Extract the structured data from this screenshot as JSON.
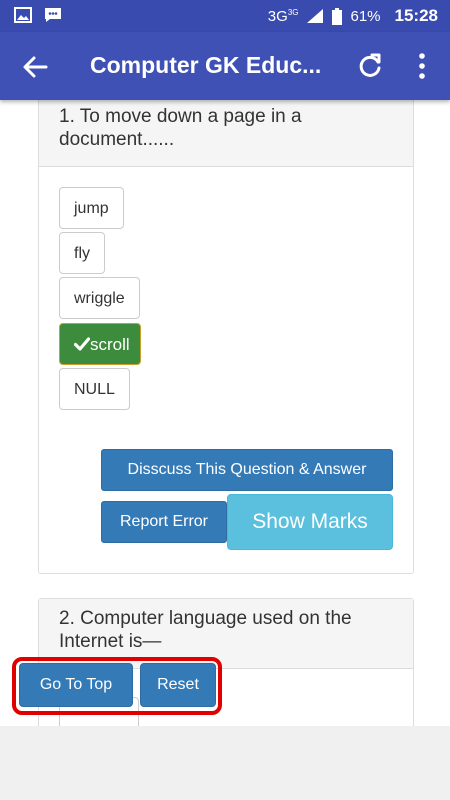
{
  "status_bar": {
    "network": "3G",
    "network_sup": "3G",
    "battery": "61%",
    "time": "15:28"
  },
  "app_bar": {
    "title": "Computer GK Educ..."
  },
  "questions": [
    {
      "text": "1. To move down a page in a document......",
      "options": [
        "jump",
        "fly",
        "wriggle",
        "scroll",
        "NULL"
      ],
      "correct_option": "scroll",
      "discuss_label": "Disscuss This Question & Answer",
      "report_label": "Report Error",
      "show_marks_label": "Show Marks"
    },
    {
      "text": "2. Computer language used on the Internet is—"
    }
  ],
  "floating": {
    "go_to_top_label": "Go To Top",
    "reset_label": "Reset",
    "highlight_color": "#e00000"
  },
  "colors": {
    "app_bar": "#3f51b5",
    "status_bar": "#3a4bb0",
    "primary_button": "#337ab7",
    "info_button": "#5bc0de",
    "correct_answer": "#3d8b3d"
  }
}
